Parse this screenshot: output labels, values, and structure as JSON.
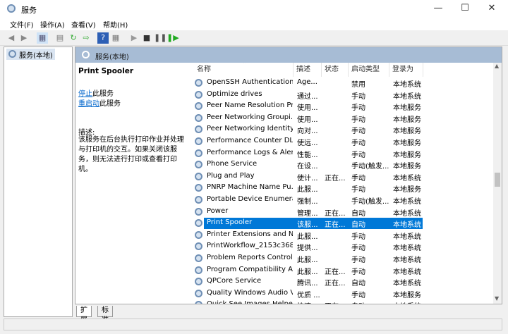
{
  "window": {
    "title": "服务"
  },
  "menu": [
    "文件(F)",
    "操作(A)",
    "查看(V)",
    "帮助(H)"
  ],
  "tree": {
    "root": "服务(本地)"
  },
  "band": {
    "title": "服务(本地)"
  },
  "details": {
    "name": "Print Spooler",
    "stop_link": "停止",
    "stop_suffix": "此服务",
    "restart_link": "重启动",
    "restart_suffix": "此服务",
    "desc_label": "描述:",
    "description": "该服务在后台执行打印作业并处理与打印机的交互。如果关闭该服务，则无法进行打印或查看打印机。"
  },
  "columns": [
    "名称",
    "描述",
    "状态",
    "启动类型",
    "登录为"
  ],
  "rows": [
    [
      "OpenSSH Authentication ...",
      "Age...",
      "",
      "禁用",
      "本地系统"
    ],
    [
      "Optimize drives",
      "通过...",
      "",
      "手动",
      "本地系统"
    ],
    [
      "Peer Name Resolution Pr...",
      "使用...",
      "",
      "手动",
      "本地服务"
    ],
    [
      "Peer Networking Groupi...",
      "使用...",
      "",
      "手动",
      "本地服务"
    ],
    [
      "Peer Networking Identity...",
      "向对...",
      "",
      "手动",
      "本地服务"
    ],
    [
      "Performance Counter DL...",
      "使远...",
      "",
      "手动",
      "本地服务"
    ],
    [
      "Performance Logs & Aler...",
      "性能...",
      "",
      "手动",
      "本地服务"
    ],
    [
      "Phone Service",
      "在设...",
      "",
      "手动(触发...",
      "本地服务"
    ],
    [
      "Plug and Play",
      "使计...",
      "正在...",
      "手动",
      "本地系统"
    ],
    [
      "PNRP Machine Name Pu...",
      "此服...",
      "",
      "手动",
      "本地服务"
    ],
    [
      "Portable Device Enumera...",
      "强制...",
      "",
      "手动(触发...",
      "本地系统"
    ],
    [
      "Power",
      "管理...",
      "正在...",
      "自动",
      "本地系统"
    ],
    [
      "Print Spooler",
      "该服...",
      "正在...",
      "自动",
      "本地系统"
    ],
    [
      "Printer Extensions and N...",
      "此服...",
      "",
      "手动",
      "本地系统"
    ],
    [
      "PrintWorkflow_2153c368",
      "提供...",
      "",
      "手动",
      "本地系统"
    ],
    [
      "Problem Reports Control...",
      "此服...",
      "",
      "手动",
      "本地系统"
    ],
    [
      "Program Compatibility A...",
      "此服...",
      "正在...",
      "手动",
      "本地系统"
    ],
    [
      "QPCore Service",
      "腾讯...",
      "正在...",
      "自动",
      "本地系统"
    ],
    [
      "Quality Windows Audio V...",
      "优质 ...",
      "",
      "手动",
      "本地服务"
    ],
    [
      "Quick See Images Helpe...",
      "快速...",
      "正在...",
      "自动",
      "本地系统"
    ]
  ],
  "selected_row": 12,
  "tabs": [
    "扩展",
    "标准"
  ],
  "colors": {
    "selection": "#0078d7",
    "band": "#a7bcd5"
  }
}
